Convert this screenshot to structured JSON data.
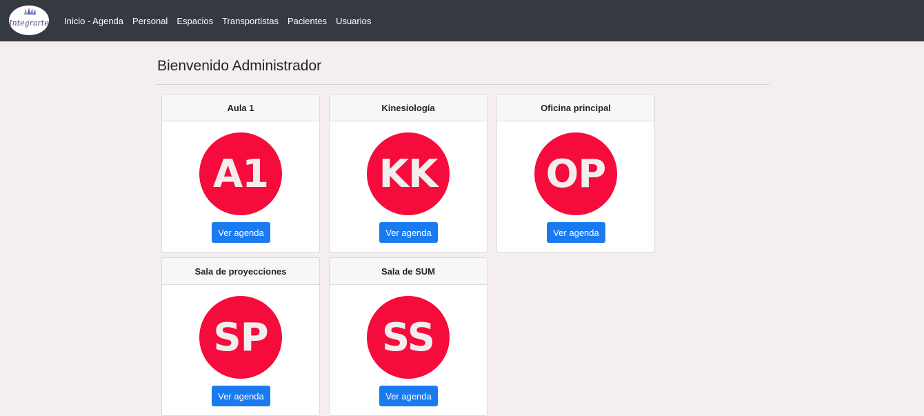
{
  "navbar": {
    "logo_text": "Integrarte",
    "links": [
      "Inicio - Agenda",
      "Personal",
      "Espacios",
      "Transportistas",
      "Pacientes",
      "Usuarios"
    ]
  },
  "main": {
    "title": "Bienvenido Administrador",
    "cards": [
      {
        "header": "Aula 1",
        "initials": "A1",
        "button": "Ver agenda"
      },
      {
        "header": "Kinesiología",
        "initials": "KK",
        "button": "Ver agenda"
      },
      {
        "header": "Oficina principal",
        "initials": "OP",
        "button": "Ver agenda"
      },
      {
        "header": "Sala de proyecciones",
        "initials": "SP",
        "button": "Ver agenda"
      },
      {
        "header": "Sala de SUM",
        "initials": "SS",
        "button": "Ver agenda"
      }
    ]
  },
  "colors": {
    "navbar": "#343a40",
    "background": "#f4eeee",
    "avatar": "#f50c3d",
    "button": "#1a7bf0"
  }
}
